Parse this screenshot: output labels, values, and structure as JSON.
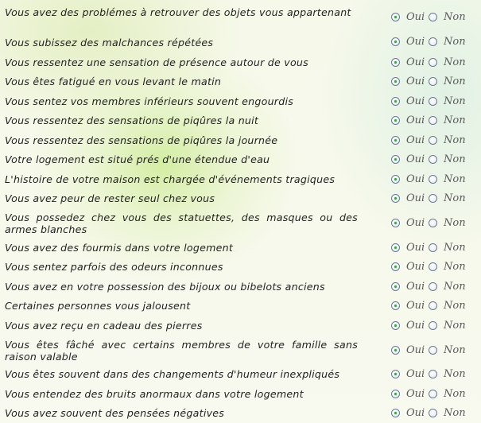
{
  "options": {
    "yes": "Oui",
    "no": "Non"
  },
  "questions": [
    {
      "text": "Vous avez des problémes à retrouver des objets vous appartenant",
      "answer": "Oui"
    },
    {
      "text": "Vous subissez des malchances répétées",
      "answer": "Oui"
    },
    {
      "text": "Vous ressentez une sensation de présence autour de vous",
      "answer": "Oui"
    },
    {
      "text": "Vous êtes fatigué en vous levant le matin",
      "answer": "Oui"
    },
    {
      "text": "Vous sentez vos membres inférieurs souvent engourdis",
      "answer": "Oui"
    },
    {
      "text": "Vous ressentez des sensations de piqûres la nuit",
      "answer": "Oui"
    },
    {
      "text": "Vous ressentez des sensations de piqûres la journée",
      "answer": "Oui"
    },
    {
      "text": "Votre logement est situé prés d'une étendue d'eau",
      "answer": "Oui"
    },
    {
      "text": "L'histoire de votre maison est chargée d'événements tragiques",
      "answer": "Oui"
    },
    {
      "text": "Vous avez peur de rester seul chez vous",
      "answer": "Oui"
    },
    {
      "text": "Vous possedez chez vous des statuettes, des masques ou des armes blanches",
      "answer": "Oui"
    },
    {
      "text": "Vous avez des fourmis dans votre logement",
      "answer": "Oui"
    },
    {
      "text": "Vous sentez parfois des odeurs inconnues",
      "answer": "Oui"
    },
    {
      "text": "Vous avez en votre possession des bijoux ou bibelots anciens",
      "answer": "Oui"
    },
    {
      "text": "Certaines personnes vous jalousent",
      "answer": "Oui"
    },
    {
      "text": "Vous avez reçu en cadeau des pierres",
      "answer": "Oui"
    },
    {
      "text": "Vous êtes fâché avec certains membres de votre famille sans raison valable",
      "answer": "Oui"
    },
    {
      "text": "Vous êtes souvent dans des changements d'humeur inexpliqués",
      "answer": "Oui"
    },
    {
      "text": "Vous entendez des bruits anormaux dans votre logement",
      "answer": "Oui"
    },
    {
      "text": "Vous avez souvent des pensées négatives",
      "answer": "Oui"
    }
  ]
}
